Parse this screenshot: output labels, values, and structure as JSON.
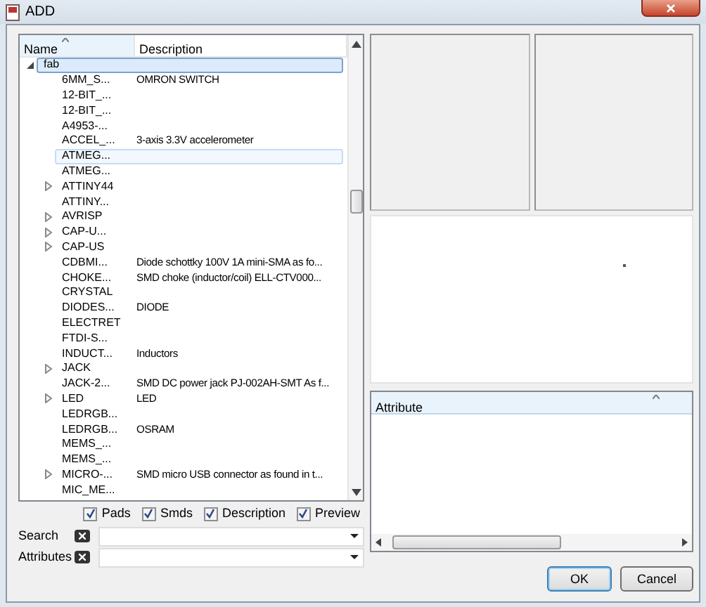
{
  "window": {
    "title": "ADD"
  },
  "tree": {
    "columns": [
      "Name",
      "Description"
    ],
    "items": [
      {
        "name": "fab",
        "expanded": true,
        "selected": true,
        "hovered": false,
        "children": [
          {
            "name": "6MM_S...",
            "description": "OMRON SWITCH",
            "expandable": false,
            "selected": false,
            "hovered": false
          },
          {
            "name": "12-BIT_...",
            "expandable": false,
            "selected": false,
            "hovered": false
          },
          {
            "name": "12-BIT_...",
            "expandable": false,
            "selected": false,
            "hovered": false
          },
          {
            "name": "A4953-...",
            "expandable": false,
            "selected": false,
            "hovered": false
          },
          {
            "name": "ACCEL_...",
            "description": "3-axis 3.3V accelerometer",
            "expandable": false,
            "selected": false,
            "hovered": false
          },
          {
            "name": "ATMEG...",
            "expandable": false,
            "selected": false,
            "hovered": true
          },
          {
            "name": "ATMEG...",
            "expandable": false,
            "selected": false,
            "hovered": false
          },
          {
            "name": "ATTINY44",
            "expandable": true,
            "selected": false,
            "hovered": false
          },
          {
            "name": "ATTINY...",
            "expandable": false,
            "selected": false,
            "hovered": false
          },
          {
            "name": "AVRISP",
            "expandable": true,
            "selected": false,
            "hovered": false
          },
          {
            "name": "CAP-U...",
            "expandable": true,
            "selected": false,
            "hovered": false
          },
          {
            "name": "CAP-US",
            "expandable": true,
            "selected": false,
            "hovered": false
          },
          {
            "name": "CDBMI...",
            "description": "Diode schottky 100V 1A mini-SMA as fo...",
            "expandable": false,
            "selected": false,
            "hovered": false
          },
          {
            "name": "CHOKE...",
            "description": "SMD choke (inductor/coil) ELL-CTV000...",
            "expandable": false,
            "selected": false,
            "hovered": false
          },
          {
            "name": "CRYSTAL",
            "expandable": false,
            "selected": false,
            "hovered": false
          },
          {
            "name": "DIODES...",
            "description": "DIODE",
            "expandable": false,
            "selected": false,
            "hovered": false
          },
          {
            "name": "ELECTRET",
            "expandable": false,
            "selected": false,
            "hovered": false
          },
          {
            "name": "FTDI-S...",
            "expandable": false,
            "selected": false,
            "hovered": false
          },
          {
            "name": "INDUCT...",
            "description": "Inductors",
            "expandable": false,
            "selected": false,
            "hovered": false
          },
          {
            "name": "JACK",
            "expandable": true,
            "selected": false,
            "hovered": false
          },
          {
            "name": "JACK-2...",
            "description": "SMD DC power jack PJ-002AH-SMT As f...",
            "expandable": false,
            "selected": false,
            "hovered": false
          },
          {
            "name": "LED",
            "description": "LED",
            "expandable": true,
            "selected": false,
            "hovered": false
          },
          {
            "name": "LEDRGB...",
            "expandable": false,
            "selected": false,
            "hovered": false
          },
          {
            "name": "LEDRGB...",
            "description": "OSRAM",
            "expandable": false,
            "selected": false,
            "hovered": false
          },
          {
            "name": "MEMS_...",
            "expandable": false,
            "selected": false,
            "hovered": false
          },
          {
            "name": "MEMS_...",
            "expandable": false,
            "selected": false,
            "hovered": false
          },
          {
            "name": "MICRO-...",
            "description": "SMD micro USB connector as found in t...",
            "expandable": true,
            "selected": false,
            "hovered": false
          },
          {
            "name": "MIC_ME...",
            "expandable": false,
            "selected": false,
            "hovered": false
          }
        ]
      }
    ]
  },
  "options": [
    {
      "label": "Pads",
      "checked": true
    },
    {
      "label": "Smds",
      "checked": true
    },
    {
      "label": "Description",
      "checked": true
    },
    {
      "label": "Preview",
      "checked": true
    }
  ],
  "filters": [
    {
      "label": "Search"
    },
    {
      "label": "Attributes"
    }
  ],
  "attribute_table": {
    "columns": [
      "Attribute"
    ]
  },
  "buttons": [
    {
      "label": "OK",
      "default": true
    },
    {
      "label": "Cancel",
      "default": false
    }
  ]
}
